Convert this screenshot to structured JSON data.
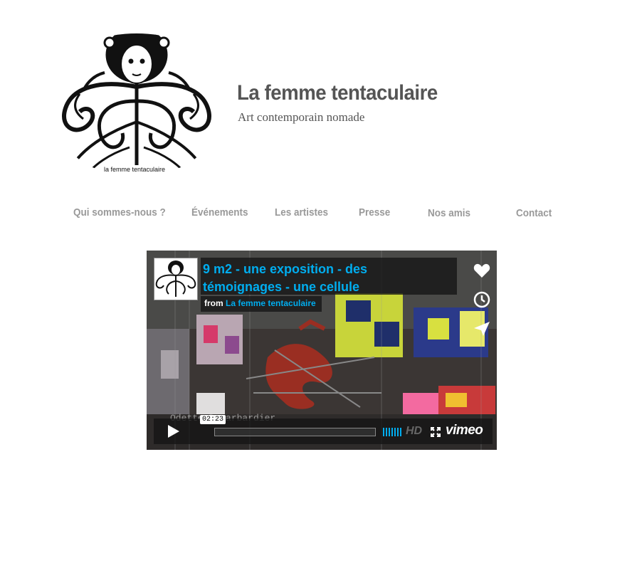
{
  "header": {
    "logo_caption": "la femme tentaculaire",
    "title": "La femme tentaculaire",
    "tagline": "Art contemporain nomade"
  },
  "nav": {
    "items": [
      {
        "label": "Qui sommes-nous ?"
      },
      {
        "label": "Événements"
      },
      {
        "label": "Les artistes"
      },
      {
        "label": "Presse"
      },
      {
        "label": "Nos amis"
      },
      {
        "label": "Contact"
      }
    ]
  },
  "video": {
    "title": "9 m2 - une exposition - des témoignages - une cellule",
    "from_prefix": "from",
    "owner": "La femme tentaculaire",
    "timecode": "02:23",
    "overlay_text": "Odette Ducarbardier",
    "hd_label": "HD",
    "brand": "vimeo",
    "progress": 0,
    "accent_color": "#00adef",
    "icons": [
      "heart-icon",
      "clock-icon",
      "send-icon",
      "play-icon",
      "volume-icon",
      "fullscreen-icon"
    ]
  }
}
